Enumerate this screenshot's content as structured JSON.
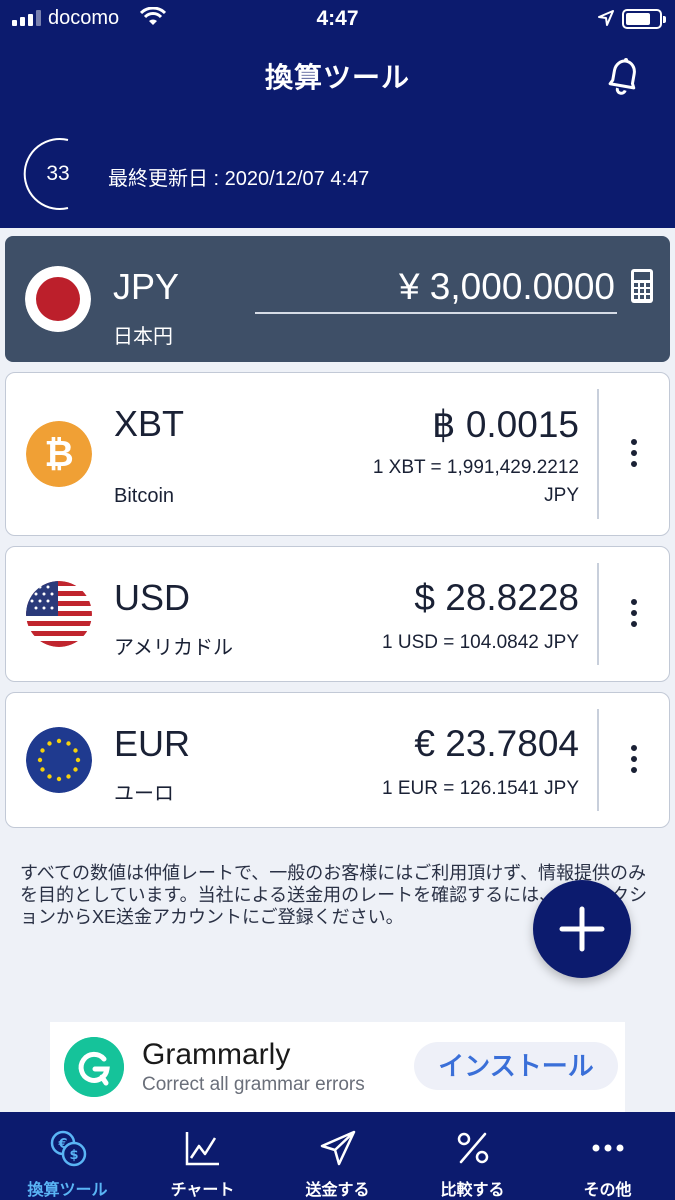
{
  "status_bar": {
    "carrier": "docomo",
    "time": "4:47"
  },
  "header": {
    "title": "換算ツール",
    "countdown": "33",
    "last_updated": "最終更新日 : 2020/12/07 4:47"
  },
  "base_currency": {
    "code": "JPY",
    "name": "日本円",
    "amount": "¥ 3,000.0000",
    "flag_icon": "japan-flag-icon"
  },
  "currencies": [
    {
      "code": "XBT",
      "name": "Bitcoin",
      "amount": "฿ 0.0015",
      "rate_line1": "1 XBT = 1,991,429.2212",
      "rate_line2": "JPY",
      "icon": "bitcoin-icon"
    },
    {
      "code": "USD",
      "name": "アメリカドル",
      "amount": "$ 28.8228",
      "rate_line1": "1 USD = 104.0842 JPY",
      "icon": "us-flag-icon"
    },
    {
      "code": "EUR",
      "name": "ユーロ",
      "amount": "€ 23.7804",
      "rate_line1": "1 EUR = 126.1541 JPY",
      "icon": "eu-flag-icon"
    }
  ],
  "disclaimer": "すべての数値は仲値レートで、一般のお客様にはご利用頂けず、情報提供のみを目的としています。当社による送金用のレートを確認するには、送金セクションからXE送金アカウントにご登録ください。",
  "ad": {
    "title": "Grammarly",
    "subtitle": "Correct all grammar errors",
    "button": "インストール"
  },
  "tabs": [
    {
      "label": "換算ツール",
      "active": true
    },
    {
      "label": "チャート",
      "active": false
    },
    {
      "label": "送金する",
      "active": false
    },
    {
      "label": "比較する",
      "active": false
    },
    {
      "label": "その他",
      "active": false
    }
  ],
  "colors": {
    "header_bg": "#0c1b6e",
    "base_card_bg": "#3e4f67",
    "active_tab": "#5ab5f5",
    "bitcoin_orange": "#f0a035",
    "grammarly_green": "#15c39a"
  }
}
